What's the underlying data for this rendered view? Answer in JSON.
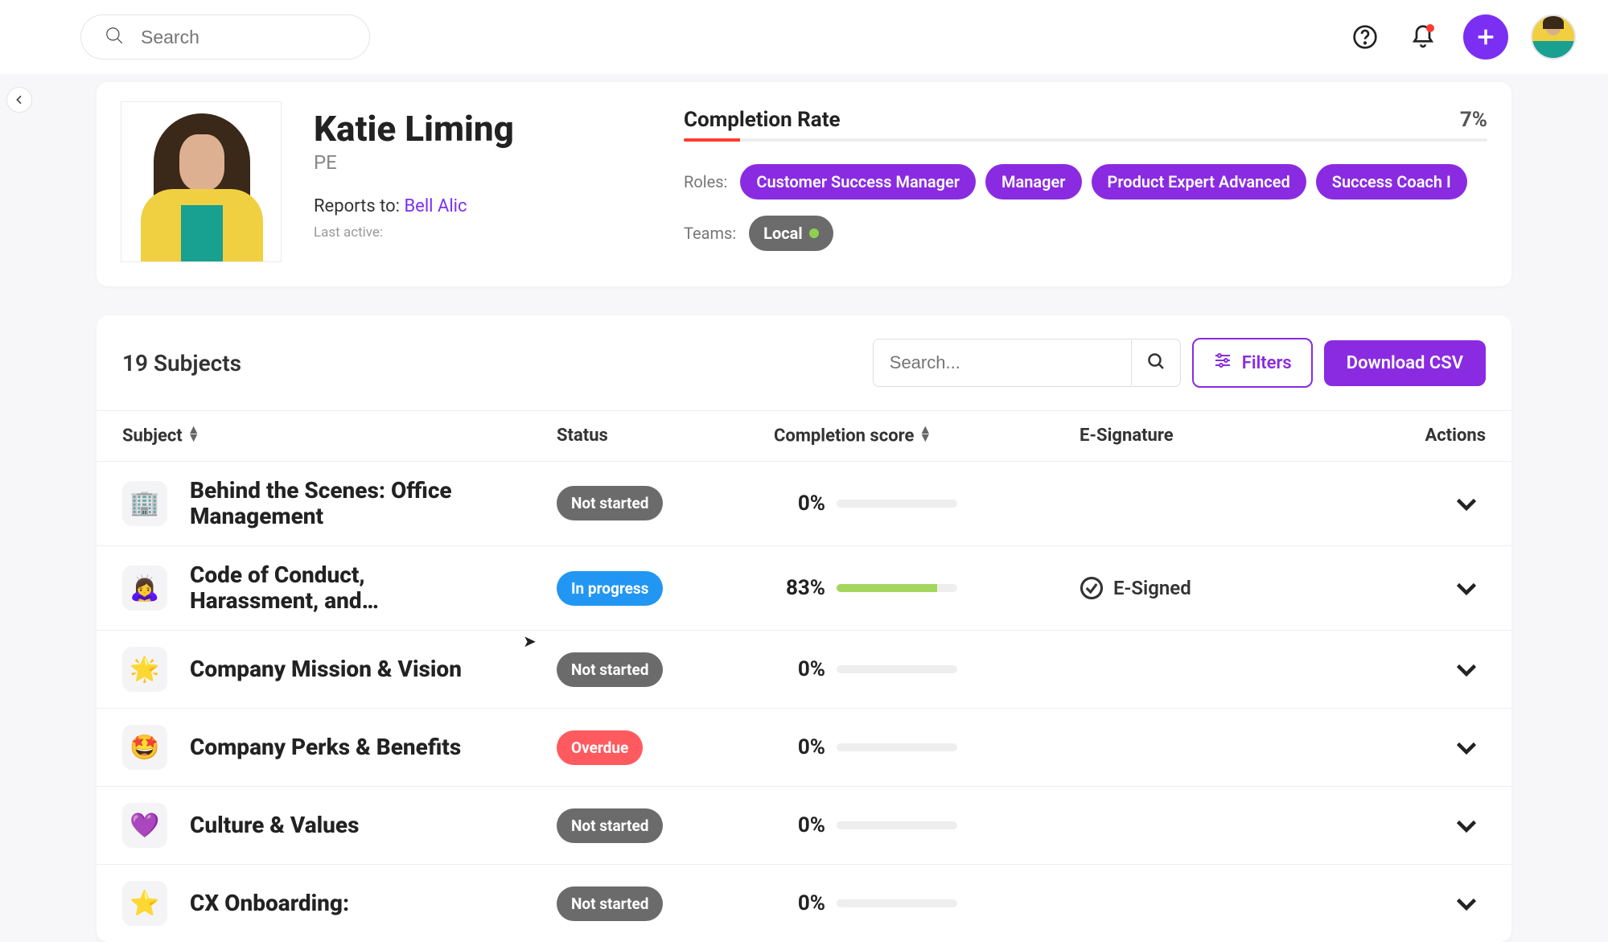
{
  "header": {
    "search_placeholder": "Search"
  },
  "profile": {
    "name": "Katie Liming",
    "subtitle": "PE",
    "reports_to_label": "Reports to: ",
    "reports_to_name": "Bell Alic",
    "last_active_label": "Last active:",
    "completion_label": "Completion Rate",
    "completion_value": "7%",
    "completion_pct": 7,
    "roles_label": "Roles:",
    "roles": [
      "Customer Success Manager",
      "Manager",
      "Product Expert Advanced",
      "Success Coach I"
    ],
    "teams_label": "Teams:",
    "teams": [
      "Local"
    ]
  },
  "subjects_header": {
    "count_label": "19 Subjects",
    "search_placeholder": "Search...",
    "filters_label": "Filters",
    "download_label": "Download CSV"
  },
  "columns": {
    "subject": "Subject",
    "status": "Status",
    "score": "Completion score",
    "esig": "E-Signature",
    "actions": "Actions"
  },
  "status_labels": {
    "not_started": "Not started",
    "in_progress": "In progress",
    "overdue": "Overdue"
  },
  "esig_label": "E-Signed",
  "rows": [
    {
      "icon": "🏢",
      "title": "Behind the Scenes: Office Management",
      "status": "not_started",
      "score": 0,
      "esigned": false
    },
    {
      "icon": "🙇‍♀️",
      "title": "Code of Conduct, Harassment, and…",
      "status": "in_progress",
      "score": 83,
      "esigned": true
    },
    {
      "icon": "🌟",
      "title": "Company Mission & Vision",
      "status": "not_started",
      "score": 0,
      "esigned": false
    },
    {
      "icon": "🤩",
      "title": "Company Perks & Benefits",
      "status": "overdue",
      "score": 0,
      "esigned": false
    },
    {
      "icon": "💜",
      "title": "Culture & Values",
      "status": "not_started",
      "score": 0,
      "esigned": false
    },
    {
      "icon": "⭐",
      "title": "CX Onboarding:",
      "status": "not_started",
      "score": 0,
      "esigned": false
    }
  ]
}
